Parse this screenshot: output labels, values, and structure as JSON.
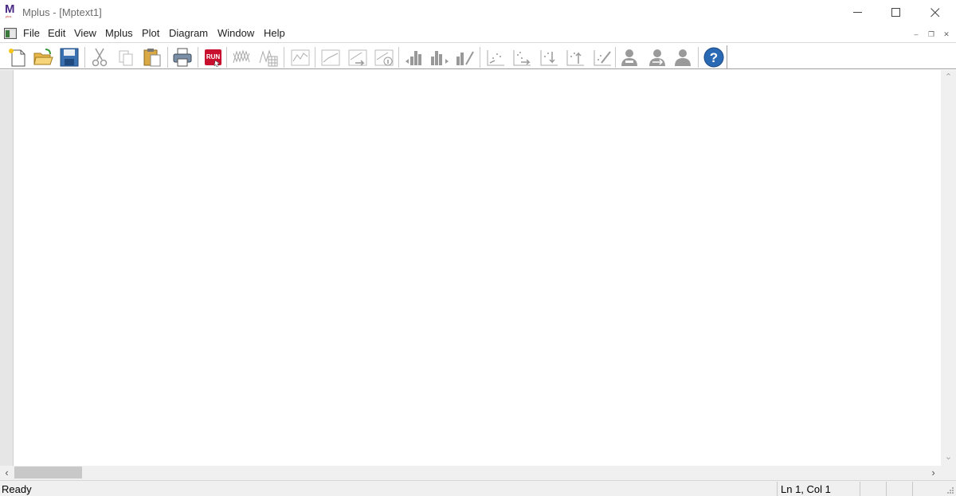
{
  "window": {
    "title": "Mplus - [Mptext1]",
    "logo_letter": "M",
    "logo_subtext": "plus"
  },
  "menubar": {
    "items": [
      "File",
      "Edit",
      "View",
      "Mplus",
      "Plot",
      "Diagram",
      "Window",
      "Help"
    ]
  },
  "toolbar": {
    "run_label": "RUN",
    "help_label": "?",
    "buttons": [
      "new-document",
      "open-folder",
      "save",
      "cut",
      "copy",
      "paste",
      "print",
      "run",
      "plot-series",
      "plot-series-grid",
      "plot-line",
      "plot-line-2",
      "plot-line-arrow",
      "plot-line-info",
      "bar-chart-left",
      "bar-chart-right",
      "bar-chart-edit",
      "scatter-left",
      "scatter-right",
      "scatter-down",
      "scatter-up",
      "scatter-edit",
      "person-remove",
      "person-arrows",
      "person",
      "help"
    ]
  },
  "status": {
    "ready": "Ready",
    "position": "Ln 1, Col 1"
  },
  "colors": {
    "logo": "#4a2a85",
    "run_button": "#c8102e",
    "help_button": "#2a6ab5"
  }
}
